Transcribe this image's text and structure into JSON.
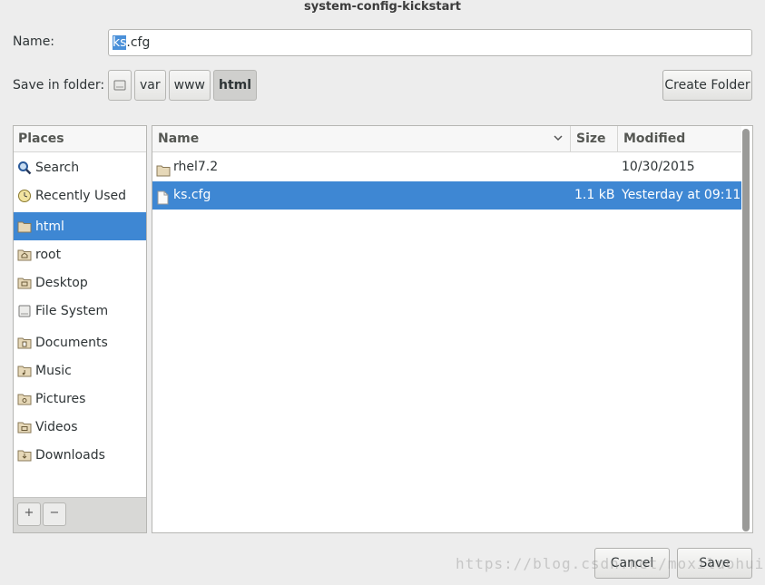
{
  "window": {
    "title": "system-config-kickstart"
  },
  "name_field": {
    "label": "Name:",
    "selected_part": "ks",
    "rest": ".cfg"
  },
  "save_in": {
    "label": "Save in folder:",
    "crumbs": [
      "var",
      "www",
      "html"
    ],
    "create_folder_label": "Create Folder"
  },
  "places": {
    "header": "Places",
    "items": [
      {
        "label": "Search",
        "icon": "search-icon"
      },
      {
        "label": "Recently Used",
        "icon": "recent-icon"
      },
      {
        "label": "html",
        "icon": "folder-icon"
      },
      {
        "label": "root",
        "icon": "home-folder-icon"
      },
      {
        "label": "Desktop",
        "icon": "desktop-folder-icon"
      },
      {
        "label": "File System",
        "icon": "drive-icon"
      },
      {
        "label": "Documents",
        "icon": "documents-folder-icon"
      },
      {
        "label": "Music",
        "icon": "music-folder-icon"
      },
      {
        "label": "Pictures",
        "icon": "pictures-folder-icon"
      },
      {
        "label": "Videos",
        "icon": "videos-folder-icon"
      },
      {
        "label": "Downloads",
        "icon": "downloads-folder-icon"
      }
    ],
    "add_label": "+",
    "remove_label": "−"
  },
  "files": {
    "columns": {
      "name": "Name",
      "size": "Size",
      "modified": "Modified"
    },
    "rows": [
      {
        "name": "rhel7.2",
        "size": "",
        "modified": "10/30/2015",
        "type": "folder"
      },
      {
        "name": "ks.cfg",
        "size": "1.1 kB",
        "modified": "Yesterday at 09:11",
        "type": "file"
      }
    ]
  },
  "buttons": {
    "cancel": "Cancel",
    "save": "Save"
  },
  "watermark": "https://blog.csdn.net/moxiluohui",
  "colors": {
    "selection": "#3e87d3",
    "background": "#ededed"
  }
}
